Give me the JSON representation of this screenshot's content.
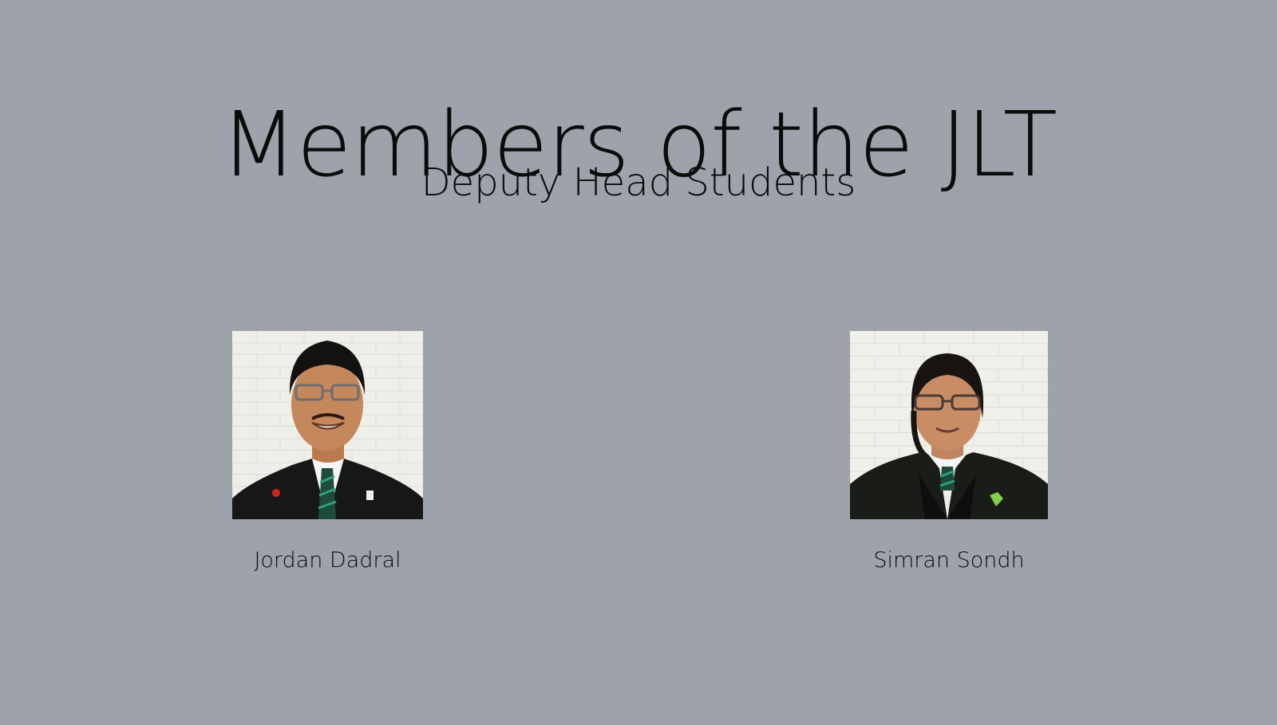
{
  "page": {
    "title": "Members of the JLT",
    "subtitle": "Deputy Head Students"
  },
  "members": [
    {
      "name": "Jordan Dadral",
      "photo": "student-portrait-photo"
    },
    {
      "name": "Simran Sondh",
      "photo": "student-portrait-photo"
    }
  ],
  "colors": {
    "background": "#9ea3ab",
    "text": "#0b0b0b"
  }
}
